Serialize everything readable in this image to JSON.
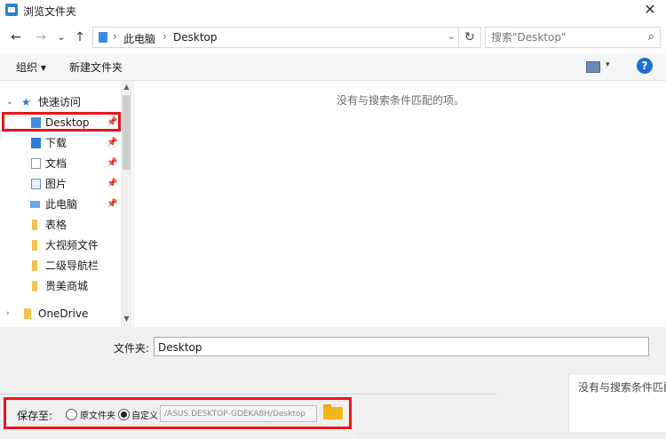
{
  "window": {
    "title": "浏览文件夹",
    "close_glyph": "✕"
  },
  "nav": {
    "back_glyph": "←",
    "forward_glyph": "→",
    "recent_glyph": "⌄",
    "up_glyph": "↑",
    "refresh_glyph": "↻",
    "dropdown_glyph": "⌄",
    "breadcrumb": [
      "此电脑",
      "Desktop"
    ],
    "sep_glyph": "›"
  },
  "search": {
    "placeholder": "搜索\"Desktop\"",
    "icon_glyph": "⌕"
  },
  "toolbar": {
    "organize_label": "组织 ▾",
    "new_folder_label": "新建文件夹",
    "view_dd_glyph": "▾",
    "help_glyph": "?"
  },
  "sidebar": {
    "quick_access": {
      "label": "快速访问",
      "expanded": true
    },
    "items": [
      {
        "label": "Desktop",
        "icon": "desktop-folder-icon",
        "pinned": true,
        "selected": true
      },
      {
        "label": "下载",
        "icon": "download-folder-icon",
        "pinned": true
      },
      {
        "label": "文档",
        "icon": "document-icon",
        "pinned": true
      },
      {
        "label": "图片",
        "icon": "picture-icon",
        "pinned": true
      },
      {
        "label": "此电脑",
        "icon": "computer-icon",
        "pinned": true
      },
      {
        "label": "表格",
        "icon": "folder-icon",
        "pinned": false
      },
      {
        "label": "大视频文件",
        "icon": "folder-icon",
        "pinned": false
      },
      {
        "label": "二级导航栏",
        "icon": "folder-icon",
        "pinned": false
      },
      {
        "label": "贵美商城",
        "icon": "folder-icon",
        "pinned": false
      }
    ],
    "onedrive": {
      "label": "OneDrive",
      "expanded": false
    },
    "pin_glyph": "📌",
    "highlight_color": "#e8141c"
  },
  "content": {
    "empty_message": "没有与搜索条件匹配的项。"
  },
  "folder_field": {
    "label": "文件夹:",
    "value": "Desktop"
  },
  "save_to": {
    "label": "保存至:",
    "options": [
      {
        "label": "原文件夹",
        "checked": false
      },
      {
        "label": "自定义",
        "checked": true
      }
    ],
    "path": "/ASUS.DESKTOP-GDEKA8H/Desktop"
  },
  "overlay_tip": {
    "text": "没有与搜索条件匹配"
  }
}
